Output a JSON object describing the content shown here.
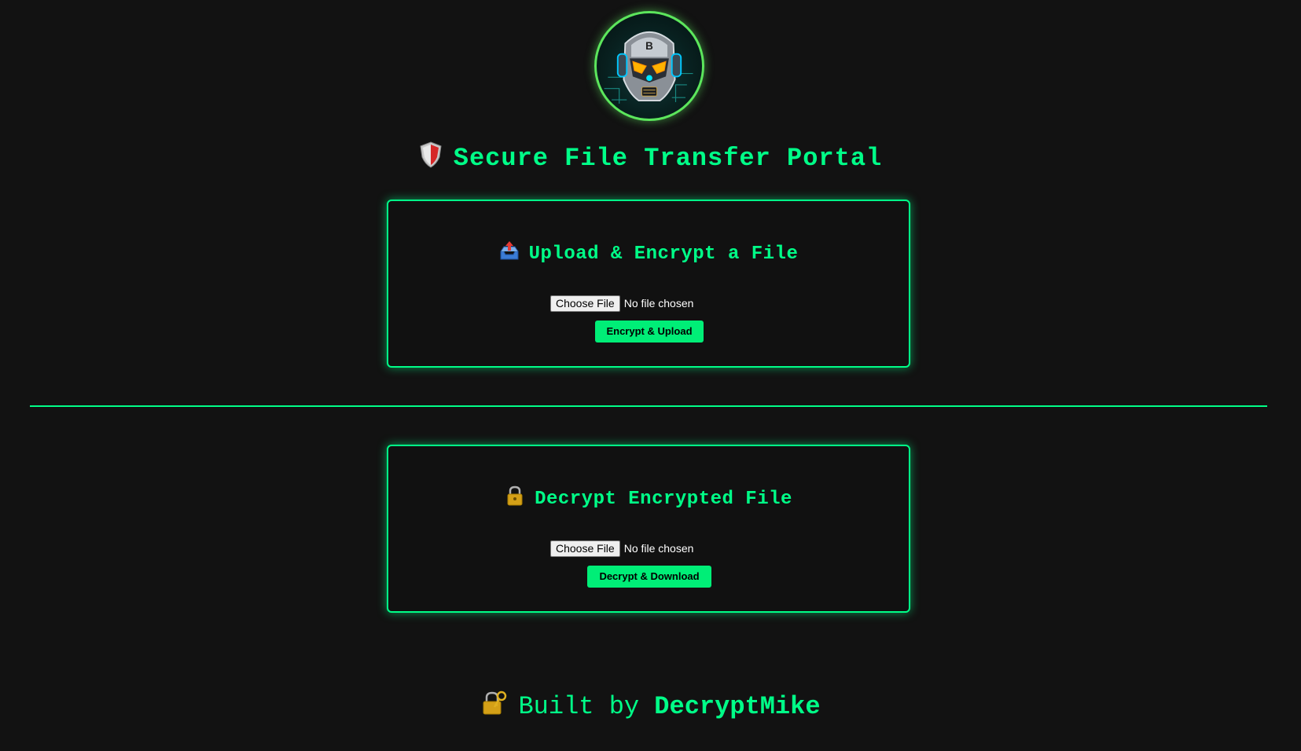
{
  "header": {
    "logo": "robot-avatar-logo",
    "logo_letter": "B",
    "title": "Secure File Transfer Portal",
    "title_icon": "shield-icon"
  },
  "upload_card": {
    "icon": "outbox-tray-icon",
    "title": "Upload & Encrypt a File",
    "file_button": "Choose File",
    "file_status": "No file chosen",
    "action_label": "Encrypt & Upload"
  },
  "decrypt_card": {
    "icon": "padlock-icon",
    "title": "Decrypt Encrypted File",
    "file_button": "Choose File",
    "file_status": "No file chosen",
    "action_label": "Decrypt & Download"
  },
  "footer": {
    "icon": "lock-with-key-icon",
    "prefix": "Built by",
    "author": "DecryptMike"
  },
  "colors": {
    "background": "#121212",
    "accent": "#00ff88",
    "button": "#00ee77",
    "logo_ring": "#5ce65c"
  }
}
